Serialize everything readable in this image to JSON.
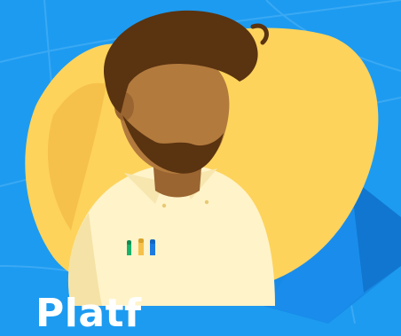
{
  "caption": {
    "text": "Platf"
  },
  "colors": {
    "background": "#1d9bf0",
    "blob": "#fdd35c",
    "blob_shadow": "#f6c14a",
    "hair": "#5a3310",
    "skin": "#b27a3d",
    "shirt": "#fff3c9",
    "triangle": "#1789e6"
  },
  "icons": [
    "person-illustration",
    "pens-in-pocket-icon",
    "blue-pyramid-shape"
  ]
}
